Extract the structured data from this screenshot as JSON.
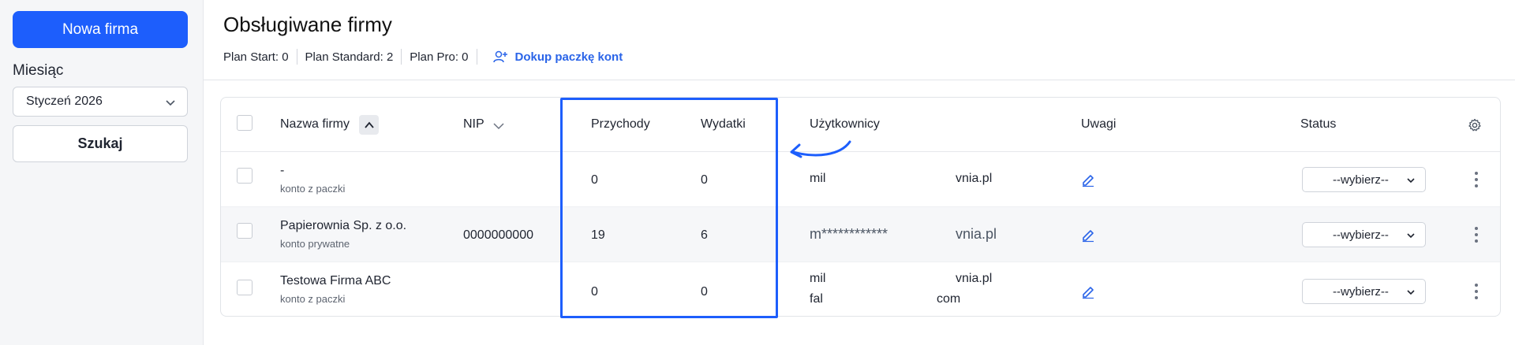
{
  "sidebar": {
    "new_company_label": "Nowa firma",
    "month_label": "Miesiąc",
    "month_value": "Styczeń 2026",
    "search_label": "Szukaj"
  },
  "header": {
    "title": "Obsługiwane firmy",
    "plans": [
      "Plan Start: 0",
      "Plan Standard: 2",
      "Plan Pro: 0"
    ],
    "buy_link": "Dokup paczkę kont"
  },
  "table": {
    "columns": {
      "name": "Nazwa firmy",
      "nip": "NIP",
      "income": "Przychody",
      "expenses": "Wydatki",
      "users": "Użytkownicy",
      "notes": "Uwagi",
      "status": "Status"
    },
    "rows": [
      {
        "name": "-",
        "sub": "konto z paczki",
        "nip": "",
        "income": "0",
        "expenses": "0",
        "user1_a": "mil",
        "user1_b": "vnia.pl",
        "user2_a": "",
        "user2_b": "",
        "status": "--wybierz--"
      },
      {
        "name": "Papierownia Sp. z o.o.",
        "sub": "konto prywatne",
        "nip": "0000000000",
        "income": "19",
        "expenses": "6",
        "user1_a": "m************",
        "user1_b": "vnia.pl",
        "user2_a": "",
        "user2_b": "",
        "status": "--wybierz--"
      },
      {
        "name": "Testowa Firma ABC",
        "sub": "konto z paczki",
        "nip": "",
        "income": "0",
        "expenses": "0",
        "user1_a": "mil",
        "user1_b": "vnia.pl",
        "user2_a": "fal",
        "user2_b": "com",
        "status": "--wybierz--"
      }
    ]
  },
  "colors": {
    "accent": "#1d5efc",
    "link": "#2a64e8"
  },
  "icons": [
    "chevron-down-icon",
    "sort-up-icon",
    "add-user-icon",
    "gear-icon",
    "edit-icon",
    "kebab-icon",
    "curved-arrow-icon"
  ]
}
